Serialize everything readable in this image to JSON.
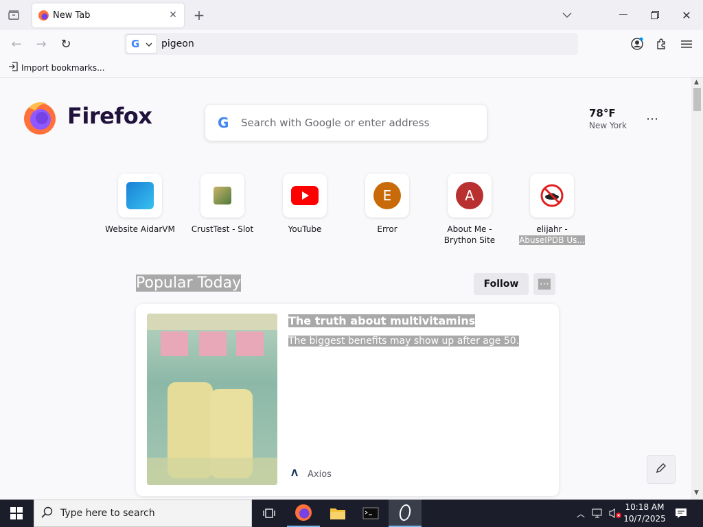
{
  "tab": {
    "title": "New Tab"
  },
  "urlbar": {
    "value": "pigeon"
  },
  "bookmarks": {
    "import": "Import bookmarks..."
  },
  "brand": {
    "name": "Firefox"
  },
  "search": {
    "placeholder": "Search with Google or enter address"
  },
  "weather": {
    "temp": "78°F",
    "city": "New York"
  },
  "shortcuts": [
    {
      "label": "Website AidarVM"
    },
    {
      "label": "CrustTest - Slot"
    },
    {
      "label": "YouTube"
    },
    {
      "label": "Error",
      "letter": "E"
    },
    {
      "label": "About Me -",
      "label2": "Brython Site",
      "letter": "A"
    },
    {
      "label": "elijahr -",
      "label2": "AbuseIPDB Us..."
    }
  ],
  "popular": {
    "heading": "Popular Today",
    "follow": "Follow"
  },
  "story": {
    "title": "The truth about multivitamins",
    "excerpt": "The biggest benefits may show up after age 50.",
    "source": "Axios"
  },
  "taskbar": {
    "search_placeholder": "Type here to search",
    "time": "10:18 AM",
    "date": "10/7/2025"
  },
  "colors": {
    "accent": "#0060df",
    "error_tile": "#c86a0a",
    "about_tile": "#b8302f",
    "youtube": "#ff0000",
    "taskbar": "#1b1d2a"
  }
}
